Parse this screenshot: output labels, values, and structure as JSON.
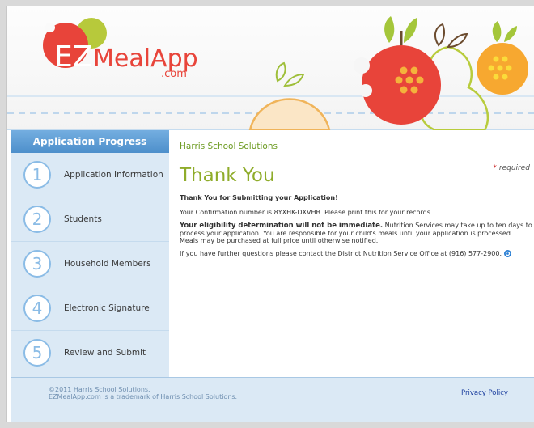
{
  "header": {
    "logo_ez": "EZ",
    "logo_meal": "MealApp",
    "logo_com": ".com"
  },
  "sidebar": {
    "title": "Application Progress",
    "steps": [
      {
        "number": "1",
        "label": "Application Information"
      },
      {
        "number": "2",
        "label": "Students"
      },
      {
        "number": "3",
        "label": "Household Members"
      },
      {
        "number": "4",
        "label": "Electronic Signature"
      },
      {
        "number": "5",
        "label": "Review and Submit"
      }
    ]
  },
  "main": {
    "company": "Harris School Solutions",
    "required_star": "*",
    "required_label": "required",
    "heading": "Thank You",
    "subheading": "Thank You for Submitting your Application!",
    "confirmation": "Your Confirmation number is 8YXHK-DXVHB. Please print this for your records.",
    "eligibility_bold": "Your eligibility determination will not be immediate.",
    "eligibility_rest": " Nutrition Services may take up to ten days to process your application. You are responsible for your child's meals until your application is processed. Meals may be purchased at full price until otherwise notified.",
    "contact": "If you have further questions please contact the District Nutrition Service Office at (916) 577-2900."
  },
  "footer": {
    "copyright": "©2011 Harris School Solutions.",
    "trademark": "EZMealApp.com is a trademark of Harris School Solutions.",
    "privacy": "Privacy Policy"
  },
  "colors": {
    "accent_blue": "#5a9bd6",
    "accent_green": "#8fac2a",
    "apple_red": "#e8443a",
    "orange": "#f7a830"
  }
}
